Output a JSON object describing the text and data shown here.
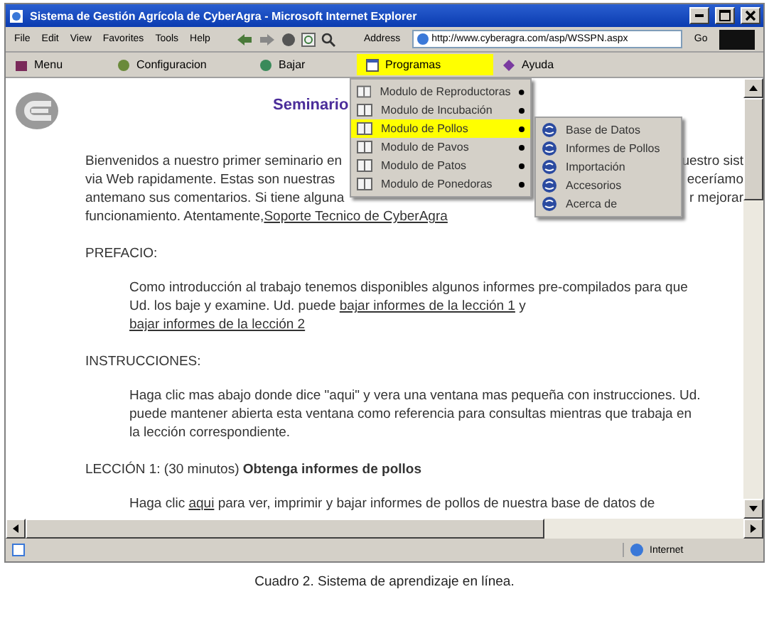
{
  "window": {
    "title": "Sistema de Gestión Agrícola de CyberAgra - Microsoft Internet Explorer"
  },
  "menu_bar": [
    "File",
    "Edit",
    "View",
    "Favorites",
    "Tools",
    "Help"
  ],
  "address": {
    "label": "Address",
    "value": "http://www.cyberagra.com/asp/WSSPN.aspx",
    "go": "Go"
  },
  "links_bar": [
    {
      "label": "Menu",
      "selected": false
    },
    {
      "label": "Configuracion",
      "selected": false
    },
    {
      "label": "Bajar",
      "selected": false
    },
    {
      "label": "Programas",
      "selected": true
    },
    {
      "label": "Ayuda",
      "selected": false
    }
  ],
  "dropdown": [
    {
      "label": "Modulo de Reproductoras",
      "selected": false
    },
    {
      "label": "Modulo de Incubación",
      "selected": false
    },
    {
      "label": "Modulo de Pollos",
      "selected": true
    },
    {
      "label": "Modulo de Pavos",
      "selected": false
    },
    {
      "label": "Modulo de Patos",
      "selected": false
    },
    {
      "label": "Modulo de Ponedoras",
      "selected": false
    }
  ],
  "submenu": [
    "Base de Datos",
    "Informes de Pollos",
    "Importación",
    "Accesorios",
    "Acerca de"
  ],
  "page": {
    "heading": "Seminario",
    "intro": [
      {
        "left": "Bienvenidos a nuestro primer seminario en",
        "right": "uestro sist"
      },
      {
        "left": "via Web rapidamente. Estas son nuestras",
        "right": "eceríamo"
      },
      {
        "left": "antemano sus comentarios. Si tiene alguna",
        "right": "r mejorar"
      }
    ],
    "intro_last": {
      "text": "funcionamiento. Atentamente, ",
      "link": "Soporte Tecnico de CyberAgra"
    },
    "sections": [
      {
        "heading": "PREFACIO:",
        "parts": [
          {
            "kind": "text",
            "text": "Como introducción al trabajo tenemos disponibles algunos informes pre-compilados para que Ud. los baje y examine. Ud. puede "
          },
          {
            "kind": "link",
            "text": "bajar informes de la lección 1"
          },
          {
            "kind": "text",
            "text": " y "
          },
          {
            "kind": "link",
            "text": "bajar informes de la lección 2"
          }
        ]
      },
      {
        "heading": "INSTRUCCIONES:",
        "parts": [
          {
            "kind": "text",
            "text": "Haga clic mas abajo donde dice \"aqui\" y vera una ventana mas pequeña con instrucciones. Ud. puede mantener abierta esta ventana como referencia para consultas mientras que trabaja en la lección correspondiente."
          }
        ]
      },
      {
        "heading": "LECCIÓN 1: (30 minutos) **Obtenga informes de pollos**",
        "parts": [
          {
            "kind": "text",
            "text": "Haga clic "
          },
          {
            "kind": "link",
            "text": "aqui"
          },
          {
            "kind": "text",
            "text": " para ver, imprimir y bajar informes de pollos de nuestra base de datos de"
          }
        ]
      }
    ]
  },
  "status_bar": {
    "zone": "Internet"
  },
  "caption": "Cuadro 2. Sistema de aprendizaje en línea."
}
